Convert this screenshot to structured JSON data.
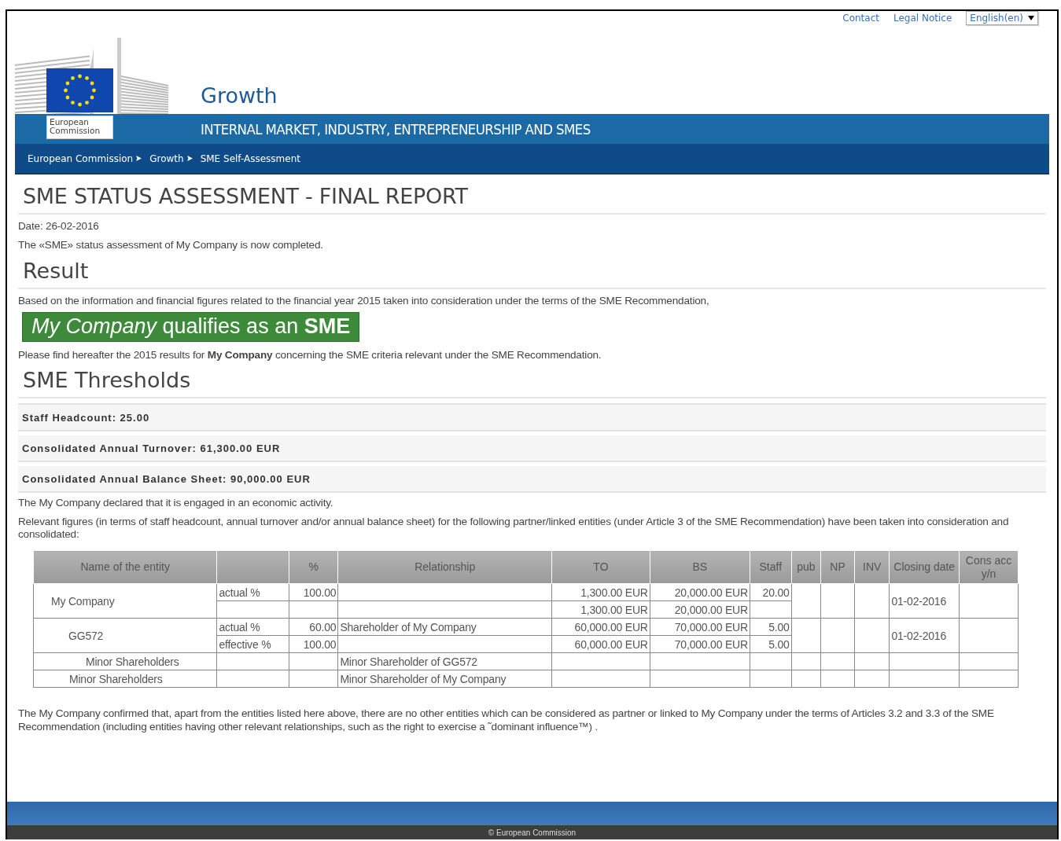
{
  "top_links": [
    {
      "label": "Contact"
    },
    {
      "label": "Legal Notice"
    }
  ],
  "language_select": {
    "value": "English(en)"
  },
  "logo": {
    "text": "European Commission"
  },
  "site": {
    "title": "Growth",
    "subtitle": "INTERNAL MARKET, INDUSTRY, ENTREPRENEURSHIP AND SMES"
  },
  "breadcrumb": [
    {
      "label": "European Commission"
    },
    {
      "label": "Growth"
    },
    {
      "label": "SME Self-Assessment"
    }
  ],
  "report": {
    "title": "SME STATUS ASSESSMENT - FINAL REPORT",
    "date": "Date: 26-02-2016",
    "intro": "The «SME» status assessment of My Company is now completed.",
    "result_heading": "Result",
    "basis": "Based on the information and financial figures related to the financial year 2015 taken into consideration under the terms of the SME Recommendation,",
    "verdict": "*My Company* qualifies as an **SME**",
    "verdict_positive": true,
    "results_note": "Please find hereafter the 2015 results for **My Company** concerning the SME criteria relevant under the SME Recommendation.",
    "thresholds_heading": "SME Thresholds",
    "thresholds": [
      {
        "text": "Staff Headcount: 25.00"
      },
      {
        "text": "Consolidated Annual Turnover: 61,300.00 EUR"
      },
      {
        "text": "Consolidated Annual Balance Sheet: 90,000.00 EUR"
      }
    ],
    "activity": "The My Company declared that it is engaged in an economic activity.",
    "relevant": "Relevant figures (in terms of staff headcount, annual turnover and/or annual balance sheet) for the following partner/linked entities (under Article 3 of the SME Recommendation) have been taken into consideration and consolidated:",
    "table": {
      "columns": [
        "Name of the entity",
        "",
        "%",
        "Relationship",
        "TO",
        "BS",
        "Staff",
        "pub",
        "NP",
        "INV",
        "Closing date",
        "Cons acc y/n"
      ],
      "entities": [
        {
          "name": "My Company",
          "closing_date": "01-02-2016",
          "lines": [
            {
              "type": "actual %",
              "pct": "100.00",
              "to": "1,300.00 EUR",
              "bs": "20,000.00 EUR",
              "staff": "20.00"
            },
            {
              "to": "1,300.00 EUR",
              "bs": "20,000.00 EUR"
            }
          ],
          "children": [
            {
              "name": "GG572",
              "closing_date": "01-02-2016",
              "lines": [
                {
                  "type": "actual %",
                  "pct": "60.00",
                  "relationship": "Shareholder of My Company",
                  "to": "60,000.00 EUR",
                  "bs": "70,000.00 EUR",
                  "staff": "5.00"
                },
                {
                  "type": "effective %",
                  "pct": "100.00",
                  "to": "60,000.00 EUR",
                  "bs": "70,000.00 EUR",
                  "staff": "5.00"
                }
              ],
              "children": [
                {
                  "name": "Minor Shareholders",
                  "lines": [
                    {
                      "relationship": "Minor Shareholder of GG572"
                    }
                  ]
                }
              ]
            },
            {
              "name": "Minor Shareholders",
              "lines": [
                {
                  "relationship": "Minor Shareholder of My Company"
                }
              ]
            }
          ]
        }
      ]
    },
    "confirmation": "The My Company confirmed that, apart from the entities listed here above, there are no other entities which can be considered as partner or linked to My Company under the terms of Articles 3.2 and 3.3 of the SME Recommendation (including entities having other relevant relationships, such as the right to exercise a ˜dominant influence™) ."
  },
  "footer": {
    "copyright": "© European Commission"
  }
}
